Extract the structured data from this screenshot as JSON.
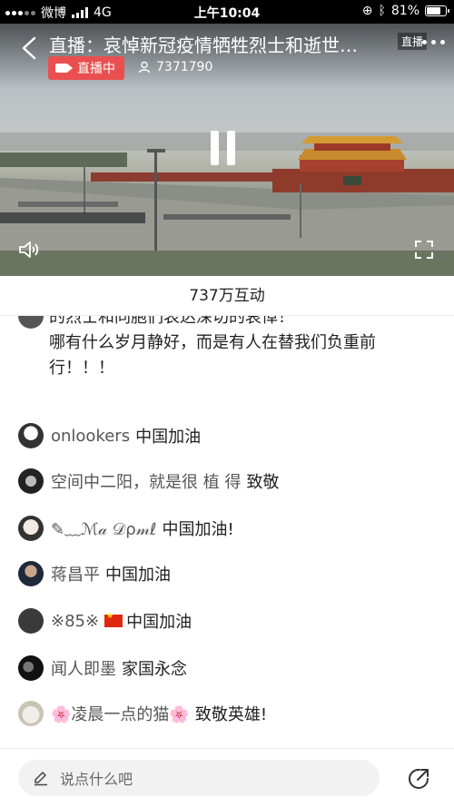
{
  "status_bar": {
    "carrier": "微博",
    "network": "4G",
    "time": "上午10:04",
    "battery": "81%",
    "battery_level": 0.81
  },
  "video": {
    "title": "直播：哀悼新冠疫情牺牲烈士和逝世…",
    "live_tag": "直播",
    "live_badge": "直播中",
    "viewer_count": "7371790",
    "icons": [
      "back-icon",
      "more-icon",
      "camera-icon",
      "user-icon",
      "pause-icon",
      "volume-icon",
      "fullscreen-icon"
    ]
  },
  "interaction": {
    "label": "737万互动"
  },
  "comments": {
    "partial": {
      "line1": "的烈士和同胞们表达深切的哀悼！",
      "line2": "哪有什么岁月静好，而是有人在替我们负重前",
      "line3": "行！！！"
    },
    "items": [
      {
        "name": "onlookers",
        "text": "中国加油"
      },
      {
        "name": "空间中二阳，就是很 植 得",
        "text": "致敬"
      },
      {
        "name": "✎﹏ℳ𝒶 𝒟ρ𝓂ℓ",
        "text": "中国加油!"
      },
      {
        "name": "蒋昌平",
        "text": "中国加油"
      },
      {
        "name": "※85※",
        "text": "中国加油"
      },
      {
        "name": "闻人即墨",
        "text": "家国永念"
      },
      {
        "name": "🌸凌晨一点的猫🌸",
        "text": "致敬英雄!"
      }
    ]
  },
  "input": {
    "placeholder": "说点什么吧"
  }
}
